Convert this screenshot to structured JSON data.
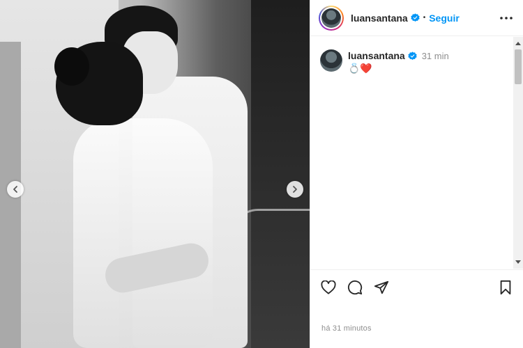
{
  "post": {
    "username": "luansantana",
    "follow_label": "Seguir",
    "separator": "•",
    "caption": {
      "username": "luansantana",
      "time": "31 min",
      "text": "💍❤️"
    },
    "timestamp": "há 31 minutos"
  },
  "icons": {
    "verified": "verified-badge-icon",
    "more": "more-options-icon",
    "like": "heart-icon",
    "comment": "comment-icon",
    "share": "send-icon",
    "save": "bookmark-icon",
    "prev": "chevron-left-icon",
    "next": "chevron-right-icon"
  },
  "colors": {
    "accent": "#0095f6",
    "text": "#262626",
    "muted": "#8e8e8e"
  }
}
